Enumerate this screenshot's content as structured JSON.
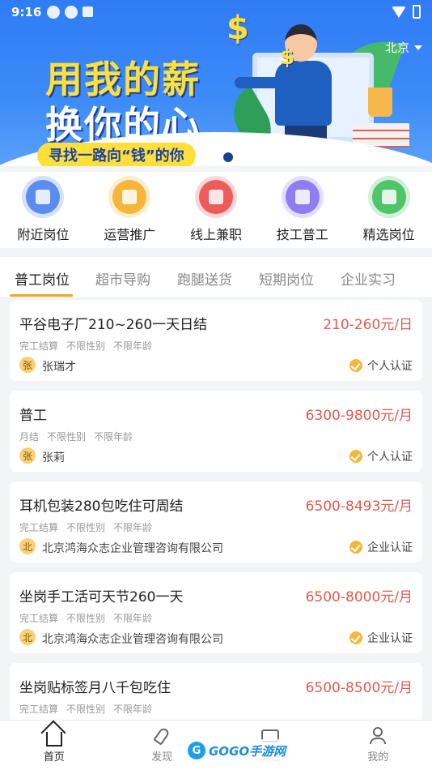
{
  "status_bar": {
    "time": "9:16"
  },
  "banner": {
    "city": "北京",
    "slogan_line1": "用我的薪",
    "slogan_line2": "换你的心",
    "subtitle": "寻找一路向“钱”的你",
    "dollar_glyph": "$"
  },
  "categories": [
    {
      "label": "附近岗位",
      "color": "#5b8def",
      "icon": "building-icon"
    },
    {
      "label": "运营推广",
      "color": "#f5b73b",
      "icon": "coins-icon"
    },
    {
      "label": "线上兼职",
      "color": "#ef5a5a",
      "icon": "layers-icon"
    },
    {
      "label": "技工普工",
      "color": "#8f7cf0",
      "icon": "card-icon"
    },
    {
      "label": "精选岗位",
      "color": "#4fc46a",
      "icon": "trophy-icon"
    }
  ],
  "tabs": [
    {
      "label": "普工岗位",
      "active": true
    },
    {
      "label": "超市导购",
      "active": false
    },
    {
      "label": "跑腿送货",
      "active": false
    },
    {
      "label": "短期岗位",
      "active": false
    },
    {
      "label": "企业实习",
      "active": false
    }
  ],
  "jobs": [
    {
      "title": "平谷电子厂210~260一天日结",
      "salary": "210-260元/日",
      "tags": [
        "完工结算",
        "不限性别",
        "不限年龄"
      ],
      "avatar": "张",
      "owner": "张瑞才",
      "cert": "个人认证"
    },
    {
      "title": "普工",
      "salary": "6300-9800元/月",
      "tags": [
        "月结",
        "不限性别",
        "不限年龄"
      ],
      "avatar": "张",
      "owner": "张莉",
      "cert": "个人认证"
    },
    {
      "title": "耳机包装280包吃住可周结",
      "salary": "6500-8493元/月",
      "tags": [
        "完工结算",
        "不限性别",
        "不限年龄"
      ],
      "avatar": "北",
      "owner": "北京鸿海众志企业管理咨询有限公司",
      "cert": "企业认证"
    },
    {
      "title": "坐岗手工活可天节260一天",
      "salary": "6500-8000元/月",
      "tags": [
        "完工结算",
        "不限性别",
        "不限年龄"
      ],
      "avatar": "北",
      "owner": "北京鸿海众志企业管理咨询有限公司",
      "cert": "企业认证"
    },
    {
      "title": "坐岗贴标签月八千包吃住",
      "salary": "6500-8500元/月",
      "tags": [
        "完工结算",
        "不限性别",
        "不限年龄"
      ],
      "avatar": "",
      "owner": "",
      "cert": ""
    }
  ],
  "bottom_nav": [
    {
      "label": "首页",
      "active": true
    },
    {
      "label": "发现",
      "active": false
    },
    {
      "label": "消息",
      "active": false
    },
    {
      "label": "我的",
      "active": false
    }
  ],
  "watermark": {
    "logo_letter": "G",
    "text": "GOGO手游网"
  }
}
